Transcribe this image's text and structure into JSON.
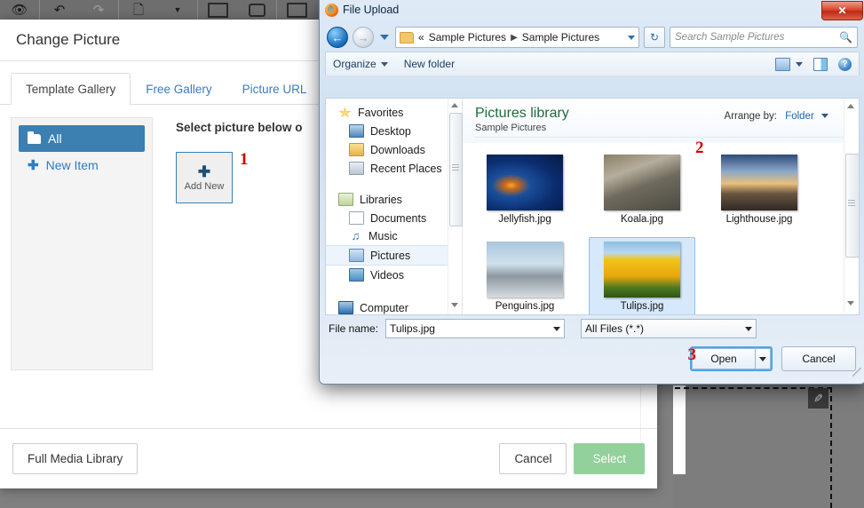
{
  "app": {
    "toolbar_icons": [
      "eye-icon",
      "undo-icon",
      "redo-icon",
      "page-icon",
      "rect-icon",
      "rounded-rect-icon",
      "box-icon"
    ],
    "canvas_tool": "pencil-icon"
  },
  "change_picture": {
    "title": "Change Picture",
    "tabs": [
      {
        "label": "Template Gallery",
        "active": true
      },
      {
        "label": "Free Gallery",
        "active": false
      },
      {
        "label": "Picture URL",
        "active": false
      }
    ],
    "sidebar": [
      {
        "label": "All",
        "icon": "folder-icon",
        "selected": true
      },
      {
        "label": "New Item",
        "icon": "plus-icon",
        "selected": false
      }
    ],
    "instruction": "Select picture below o",
    "add_new": {
      "label": "Add New",
      "icon": "plus-icon"
    },
    "markers": {
      "one": "1",
      "two": "2",
      "three": "3"
    },
    "footer": {
      "full_media_library": "Full Media Library",
      "cancel": "Cancel",
      "select": "Select"
    },
    "accent_color": "#3c7fb1",
    "select_color": "#92d19b"
  },
  "file_upload": {
    "title": "File Upload",
    "app_icon": "firefox-icon",
    "close_label": "✕",
    "nav": {
      "back_icon": "back-arrow-icon",
      "forward_icon": "forward-arrow-icon",
      "recent_icon": "chevron-down-icon",
      "breadcrumb_prefix": "«",
      "breadcrumbs": [
        "Sample Pictures",
        "Sample Pictures"
      ],
      "refresh_icon": "refresh-icon",
      "search_placeholder": "Search Sample Pictures",
      "search_icon": "search-icon"
    },
    "toolbar": {
      "organize": "Organize",
      "new_folder": "New folder",
      "view_icon": "view-layout-icon",
      "view_caret_icon": "chevron-down-icon",
      "preview_pane_icon": "preview-pane-icon",
      "help_icon": "help-icon"
    },
    "navigation_pane": [
      {
        "label": "Favorites",
        "icon": "star-icon",
        "level": 0
      },
      {
        "label": "Desktop",
        "icon": "desktop-icon",
        "level": 1
      },
      {
        "label": "Downloads",
        "icon": "downloads-icon",
        "level": 1
      },
      {
        "label": "Recent Places",
        "icon": "recent-places-icon",
        "level": 1
      },
      {
        "label": "Libraries",
        "icon": "libraries-icon",
        "level": 0
      },
      {
        "label": "Documents",
        "icon": "documents-icon",
        "level": 1
      },
      {
        "label": "Music",
        "icon": "music-icon",
        "level": 1
      },
      {
        "label": "Pictures",
        "icon": "pictures-icon",
        "level": 1,
        "selected": true
      },
      {
        "label": "Videos",
        "icon": "videos-icon",
        "level": 1
      },
      {
        "label": "Computer",
        "icon": "computer-icon",
        "level": 0
      }
    ],
    "library": {
      "title": "Pictures library",
      "subtitle": "Sample Pictures",
      "arrange_label": "Arrange by:",
      "arrange_value": "Folder"
    },
    "files": [
      {
        "name": "Jellyfish.jpg",
        "thumb": "img-jellyfish",
        "selected": false
      },
      {
        "name": "Koala.jpg",
        "thumb": "img-koala",
        "selected": false
      },
      {
        "name": "Lighthouse.jpg",
        "thumb": "img-lighthouse",
        "selected": false
      },
      {
        "name": "Penguins.jpg",
        "thumb": "img-penguins",
        "selected": false
      },
      {
        "name": "Tulips.jpg",
        "thumb": "img-tulips",
        "selected": true
      }
    ],
    "bottom": {
      "file_name_label": "File name:",
      "file_name_value": "Tulips.jpg",
      "file_type_value": "All Files (*.*)",
      "open_label": "Open",
      "cancel_label": "Cancel"
    }
  }
}
